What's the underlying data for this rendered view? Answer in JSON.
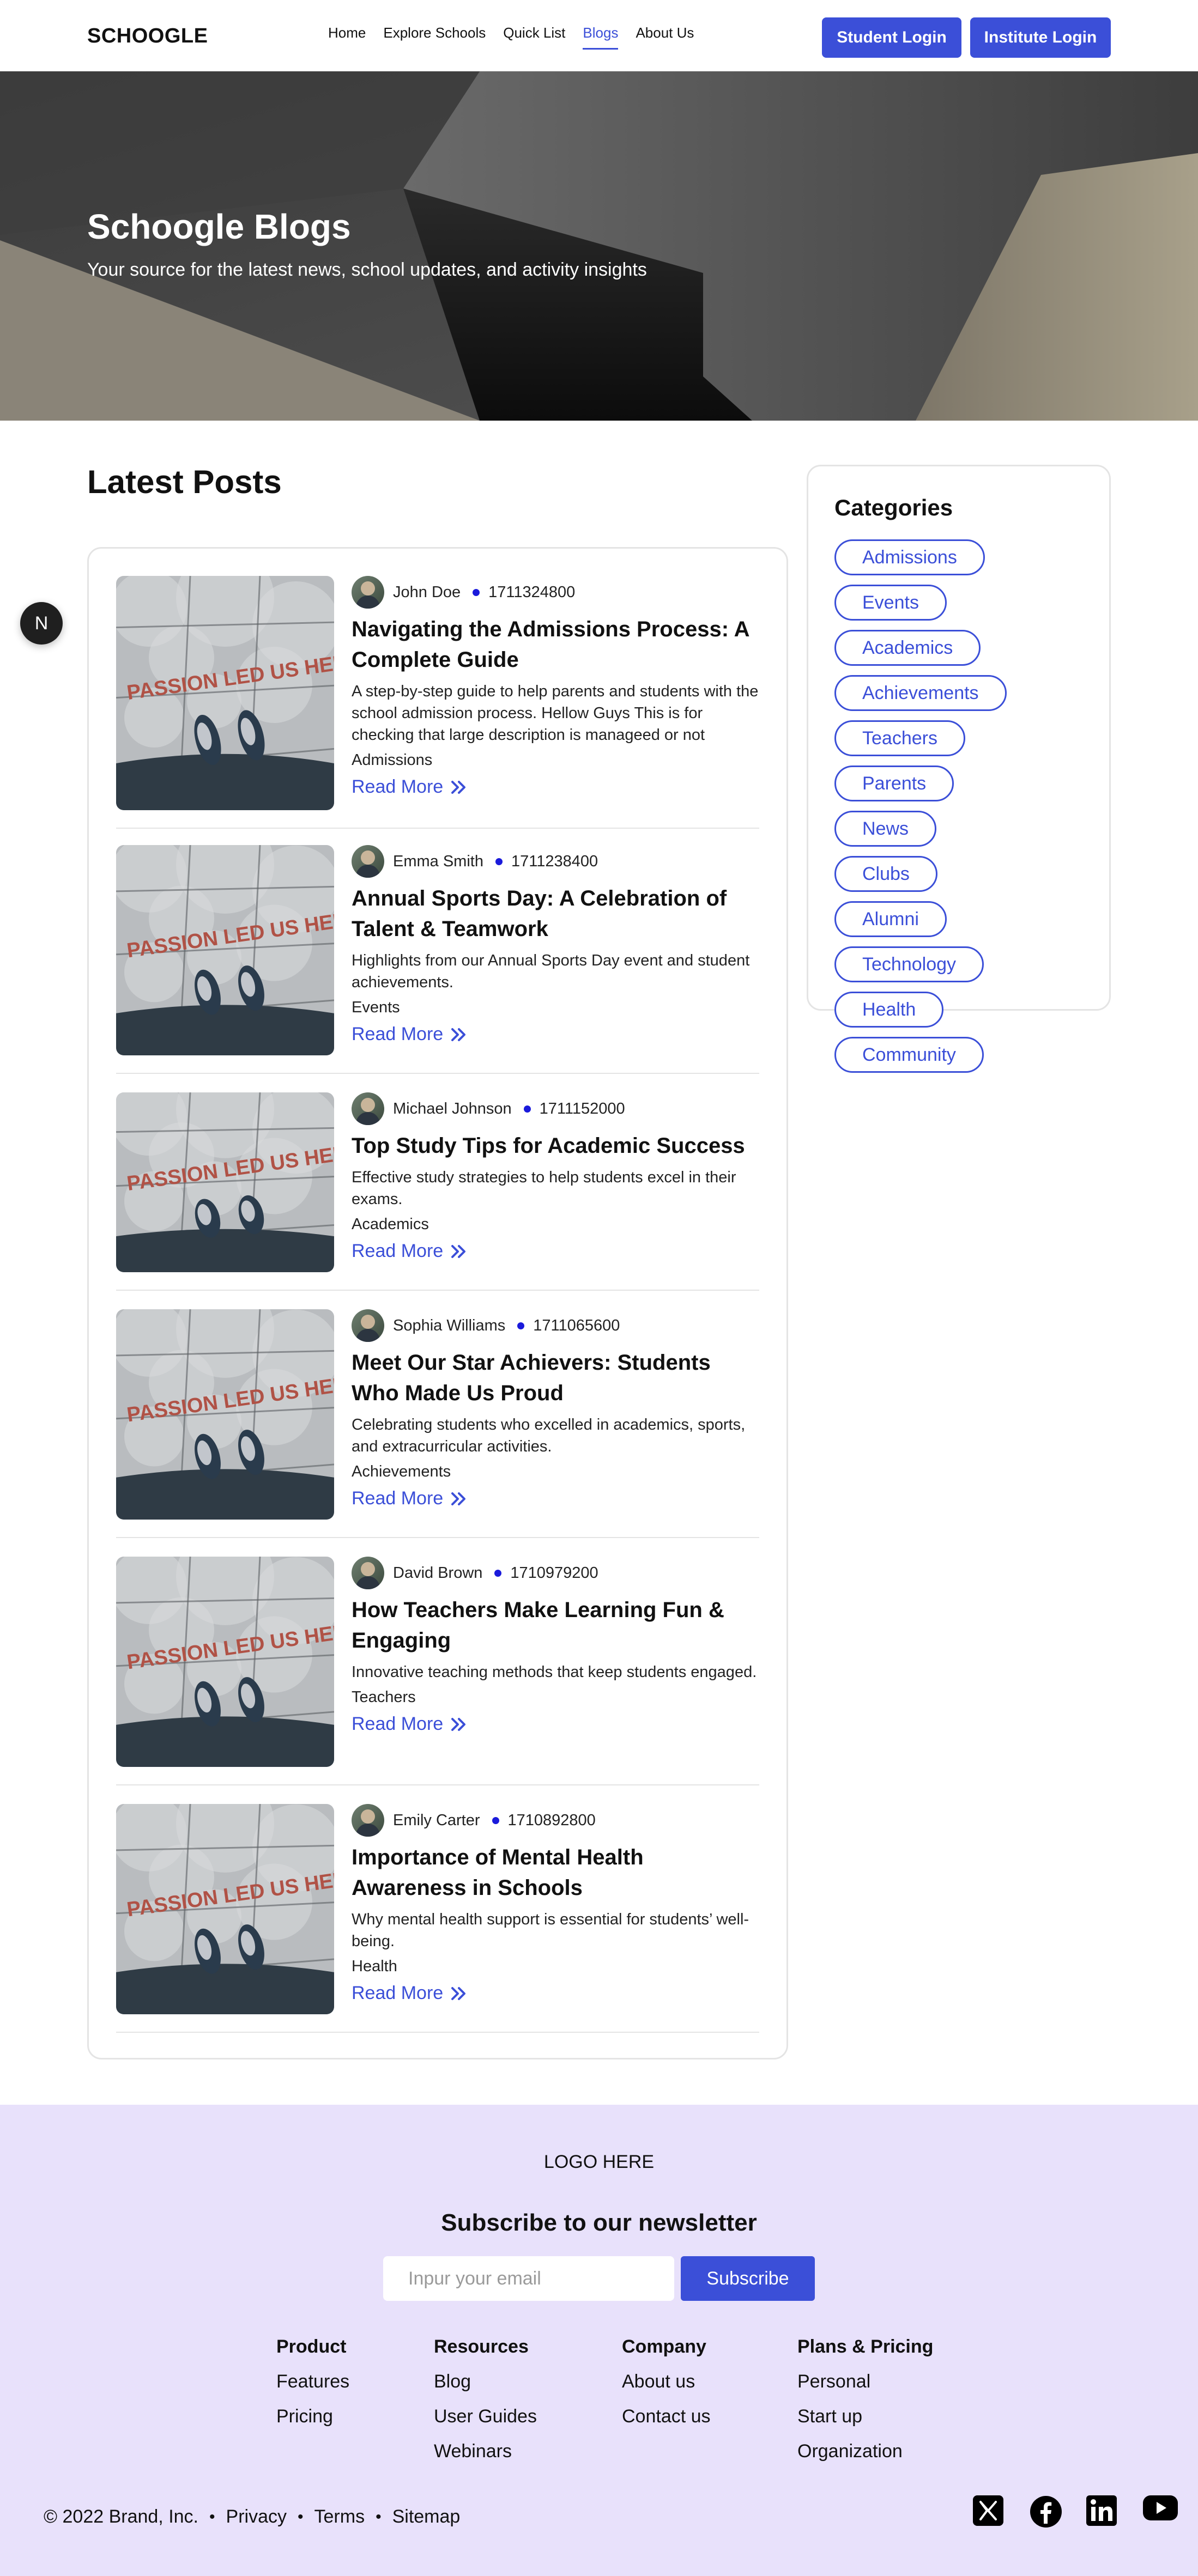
{
  "header": {
    "brand": "SCHOOGLE",
    "nav": [
      {
        "label": "Home"
      },
      {
        "label": "Explore Schools"
      },
      {
        "label": "Quick List"
      },
      {
        "label": "Blogs",
        "active": true
      },
      {
        "label": "About Us"
      }
    ],
    "student_login": "Student Login",
    "institute_login": "Institute Login"
  },
  "hero": {
    "title": "Schoogle Blogs",
    "subtitle": "Your source for the latest news, school updates, and activity insights"
  },
  "latest": {
    "title": "Latest Posts",
    "read_more": "Read More",
    "thumbnail_text": "PASSION LED US HERE",
    "posts": [
      {
        "author": "John Doe",
        "timestamp": "1711324800",
        "title": "Navigating the Admissions Process: A Complete Guide",
        "description": "A step-by-step guide to help parents and students with the school admission process. Hellow Guys This is for checking that large description is manageed or not",
        "category": "Admissions"
      },
      {
        "author": "Emma Smith",
        "timestamp": "1711238400",
        "title": "Annual Sports Day: A Celebration of Talent & Teamwork",
        "description": "Highlights from our Annual Sports Day event and student achievements.",
        "category": "Events"
      },
      {
        "author": "Michael Johnson",
        "timestamp": "1711152000",
        "title": "Top Study Tips for Academic Success",
        "description": "Effective study strategies to help students excel in their exams.",
        "category": "Academics"
      },
      {
        "author": "Sophia Williams",
        "timestamp": "1711065600",
        "title": "Meet Our Star Achievers: Students Who Made Us Proud",
        "description": "Celebrating students who excelled in academics, sports, and extracurricular activities.",
        "category": "Achievements"
      },
      {
        "author": "David Brown",
        "timestamp": "1710979200",
        "title": "How Teachers Make Learning Fun & Engaging",
        "description": "Innovative teaching methods that keep students engaged.",
        "category": "Teachers"
      },
      {
        "author": "Emily Carter",
        "timestamp": "1710892800",
        "title": "Importance of Mental Health Awareness in Schools",
        "description": "Why mental health support is essential for students’ well-being.",
        "category": "Health"
      }
    ]
  },
  "categories": {
    "title": "Categories",
    "items": [
      "Admissions",
      "Events",
      "Academics",
      "Achievements",
      "Teachers",
      "Parents",
      "News",
      "Clubs",
      "Alumni",
      "Technology",
      "Health",
      "Community"
    ]
  },
  "floating_badge": "N",
  "footer": {
    "logo": "LOGO HERE",
    "newsletter_title": "Subscribe to our newsletter",
    "email_placeholder": "Inpur your email",
    "subscribe": "Subscribe",
    "columns": [
      {
        "heading": "Product",
        "items": [
          "Features",
          "Pricing"
        ]
      },
      {
        "heading": "Resources",
        "items": [
          "Blog",
          "User Guides",
          "Webinars"
        ]
      },
      {
        "heading": "Company",
        "items": [
          "About us",
          "Contact us"
        ]
      },
      {
        "heading": "Plans & Pricing",
        "items": [
          "Personal",
          "Start up",
          "Organization"
        ]
      }
    ],
    "copyright": "© 2022 Brand, Inc.",
    "legal": [
      "Privacy",
      "Terms",
      "Sitemap"
    ],
    "socials": [
      "x-icon",
      "facebook-icon",
      "linkedin-icon",
      "youtube-icon"
    ]
  },
  "colors": {
    "accent": "#3b4fd8",
    "footer_bg": "#e8e1fb"
  }
}
